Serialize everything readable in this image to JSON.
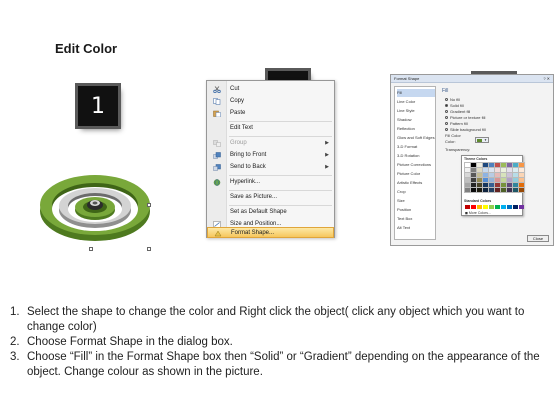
{
  "title": "Edit Color",
  "steps": {
    "one": "1",
    "two": "2",
    "three": "3"
  },
  "context_menu": {
    "items": [
      {
        "label": "Cut",
        "icon": "scissors-icon",
        "disabled": false,
        "submenu": false
      },
      {
        "label": "Copy",
        "icon": "copy-icon",
        "disabled": false,
        "submenu": false
      },
      {
        "label": "Paste",
        "icon": "paste-icon",
        "disabled": false,
        "submenu": false
      },
      {
        "label": "Edit Text",
        "icon": "",
        "disabled": false,
        "submenu": false
      },
      {
        "label": "Group",
        "icon": "group-icon",
        "disabled": true,
        "submenu": true
      },
      {
        "label": "Bring to Front",
        "icon": "bring-to-front-icon",
        "disabled": false,
        "submenu": true
      },
      {
        "label": "Send to Back",
        "icon": "send-to-back-icon",
        "disabled": false,
        "submenu": true
      },
      {
        "label": "Hyperlink...",
        "icon": "hyperlink-icon",
        "disabled": false,
        "submenu": false
      },
      {
        "label": "Save as Picture...",
        "icon": "",
        "disabled": false,
        "submenu": false
      },
      {
        "label": "Set as Default Shape",
        "icon": "",
        "disabled": false,
        "submenu": false
      },
      {
        "label": "Size and Position...",
        "icon": "size-position-icon",
        "disabled": false,
        "submenu": false
      },
      {
        "label": "Format Shape...",
        "icon": "format-shape-icon",
        "disabled": false,
        "submenu": false,
        "highlighted": true
      }
    ]
  },
  "format_dialog": {
    "title": "Format Shape",
    "categories": [
      "Fill",
      "Line Color",
      "Line Style",
      "Shadow",
      "Reflection",
      "Glow and Soft Edges",
      "3-D Format",
      "3-D Rotation",
      "Picture Corrections",
      "Picture Color",
      "Artistic Effects",
      "Crop",
      "Size",
      "Position",
      "Text Box",
      "Alt Text"
    ],
    "selected_category": "Fill",
    "pane_header": "Fill",
    "options": [
      "No fill",
      "Solid fill",
      "Gradient fill",
      "Picture or texture fill",
      "Pattern fill",
      "Slide background fill"
    ],
    "selected_option": "Solid fill",
    "fill_color_label": "Fill Color",
    "color_label": "Color:",
    "transparency_label": "Transparency:",
    "close_label": "Close",
    "palette": {
      "theme_label": "Theme Colors",
      "standard_label": "Standard Colors",
      "more_label": "More Colors...",
      "theme_colors": [
        [
          "#ffffff",
          "#000000",
          "#eeece1",
          "#1f497d",
          "#4f81bd",
          "#c0504d",
          "#9bbb59",
          "#8064a2",
          "#4bacc6",
          "#f79646"
        ],
        [
          "#f2f2f2",
          "#7f7f7f",
          "#ddd9c3",
          "#c6d9f0",
          "#dbe5f1",
          "#f2dcdb",
          "#ebf1dd",
          "#e5e0ec",
          "#dbeef3",
          "#fdeada"
        ],
        [
          "#d8d8d8",
          "#595959",
          "#c4bd97",
          "#8db3e2",
          "#b8cce4",
          "#e5b9b7",
          "#d7e3bc",
          "#ccc1d9",
          "#b7dde8",
          "#fbd5b5"
        ],
        [
          "#bfbfbf",
          "#3f3f3f",
          "#938953",
          "#548dd4",
          "#95b3d7",
          "#d99694",
          "#c3d69b",
          "#b2a2c7",
          "#92cddc",
          "#fac08f"
        ],
        [
          "#a5a5a5",
          "#262626",
          "#494429",
          "#17365d",
          "#366092",
          "#953734",
          "#76923c",
          "#5f497a",
          "#31859b",
          "#e36c09"
        ],
        [
          "#7f7f7f",
          "#0c0c0c",
          "#1d1b10",
          "#0f243e",
          "#244061",
          "#632423",
          "#4f6128",
          "#3f3151",
          "#205867",
          "#974806"
        ]
      ],
      "standard_colors": [
        "#c00000",
        "#ff0000",
        "#ffc000",
        "#ffff00",
        "#92d050",
        "#00b050",
        "#00b0f0",
        "#0070c0",
        "#002060",
        "#7030a0"
      ]
    }
  },
  "instructions": [
    {
      "num": "1.",
      "text": "Select the shape to change the color and Right click the object( click any object which you want to change color)"
    },
    {
      "num": "2.",
      "text": "Choose Format Shape in the dialog box."
    },
    {
      "num": "3.",
      "text": "Choose “Fill” in the Format Shape box then “Solid” or “Gradient” depending on the appearance of the object. Change colour as shown in the picture."
    }
  ],
  "colors": {
    "ring_green": "#6b9a2f",
    "menu_highlight": "#f6c65d"
  }
}
